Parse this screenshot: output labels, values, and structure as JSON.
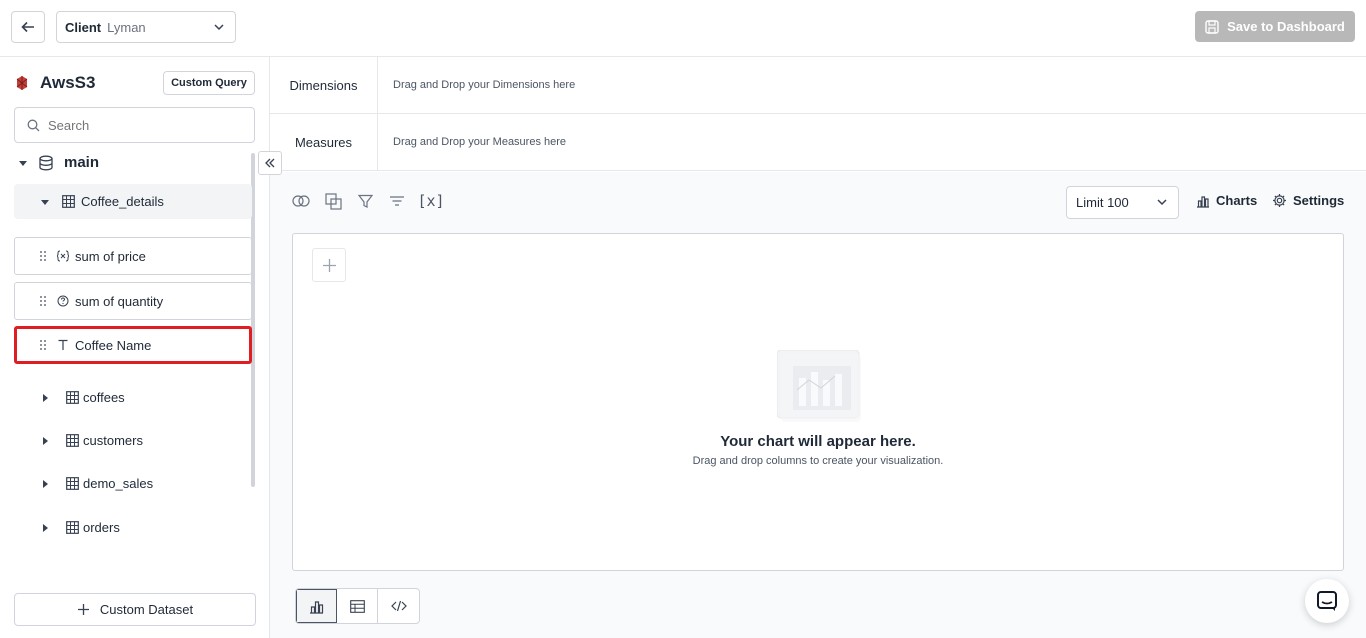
{
  "topbar": {
    "client_label": "Client",
    "client_value": "Lyman",
    "save_label": "Save to Dashboard"
  },
  "sidebar": {
    "source_name": "AwsS3",
    "custom_query_label": "Custom Query",
    "search_placeholder": "Search",
    "schema_name": "main",
    "active_table": "Coffee_details",
    "fields": [
      {
        "label": "sum of price",
        "icon": "formula-icon"
      },
      {
        "label": "sum of quantity",
        "icon": "question-icon"
      },
      {
        "label": "Coffee Name",
        "icon": "text-type-icon"
      }
    ],
    "tables": [
      "coffees",
      "customers",
      "demo_sales",
      "orders"
    ],
    "custom_dataset_label": "Custom Dataset"
  },
  "dropzones": {
    "dimensions_label": "Dimensions",
    "dimensions_hint": "Drag and Drop your Dimensions here",
    "measures_label": "Measures",
    "measures_hint": "Drag and Drop your Measures here"
  },
  "toolbar": {
    "limit_label": "Limit",
    "limit_value": "100",
    "charts_label": "Charts",
    "settings_label": "Settings",
    "variable_glyph": "[x]"
  },
  "canvas": {
    "empty_title": "Your chart will appear here.",
    "empty_subtitle": "Drag and drop columns to create your visualization."
  },
  "colors": {
    "highlight_border": "#e11d24",
    "save_button_bg": "#b8b8b8"
  }
}
